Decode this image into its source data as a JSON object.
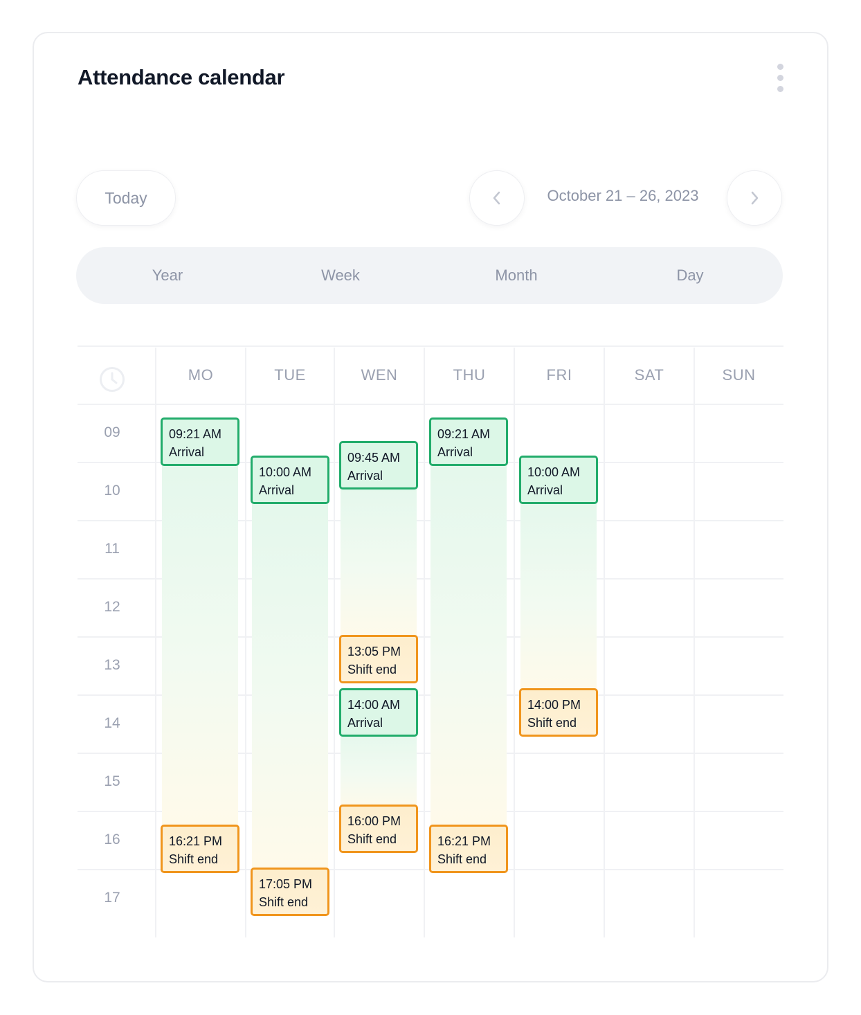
{
  "header": {
    "title": "Attendance calendar",
    "menu_icon": "kebab-menu-icon"
  },
  "toolbar": {
    "today_label": "Today",
    "prev_icon": "chevron-left-icon",
    "next_icon": "chevron-right-icon",
    "date_range": "October 21 – 26, 2023"
  },
  "view_tabs": [
    {
      "label": "Year"
    },
    {
      "label": "Week"
    },
    {
      "label": "Month"
    },
    {
      "label": "Day"
    }
  ],
  "calendar": {
    "time_icon": "clock-icon",
    "days": [
      "MO",
      "TUE",
      "WEN",
      "THU",
      "FRI",
      "SAT",
      "SUN"
    ],
    "hours": [
      "09",
      "10",
      "11",
      "12",
      "13",
      "14",
      "15",
      "16",
      "17"
    ],
    "colors": {
      "arrival_border": "#22ac6b",
      "arrival_bg": "#dcf7e7",
      "shift_end_border": "#f0951d",
      "shift_end_bg": "#fdedcb"
    },
    "events": [
      {
        "day": 0,
        "type": "arrival",
        "time": "09:21 AM",
        "label": "Arrival",
        "h": 9,
        "m": 21
      },
      {
        "day": 0,
        "type": "shiftend",
        "time": "16:21 PM",
        "label": "Shift end",
        "h": 16,
        "m": 21
      },
      {
        "day": 1,
        "type": "arrival",
        "time": "10:00 AM",
        "label": "Arrival",
        "h": 10,
        "m": 0
      },
      {
        "day": 1,
        "type": "shiftend",
        "time": "17:05 PM",
        "label": "Shift end",
        "h": 17,
        "m": 5
      },
      {
        "day": 2,
        "type": "arrival",
        "time": "09:45 AM",
        "label": "Arrival",
        "h": 9,
        "m": 45
      },
      {
        "day": 2,
        "type": "shiftend",
        "time": "13:05 PM",
        "label": "Shift end",
        "h": 13,
        "m": 5
      },
      {
        "day": 2,
        "type": "arrival",
        "time": "14:00 AM",
        "label": "Arrival",
        "h": 14,
        "m": 0
      },
      {
        "day": 2,
        "type": "shiftend",
        "time": "16:00 PM",
        "label": "Shift end",
        "h": 16,
        "m": 0
      },
      {
        "day": 3,
        "type": "arrival",
        "time": "09:21 AM",
        "label": "Arrival",
        "h": 9,
        "m": 21
      },
      {
        "day": 3,
        "type": "shiftend",
        "time": "16:21 PM",
        "label": "Shift end",
        "h": 16,
        "m": 21
      },
      {
        "day": 4,
        "type": "arrival",
        "time": "10:00 AM",
        "label": "Arrival",
        "h": 10,
        "m": 0
      },
      {
        "day": 4,
        "type": "shiftend",
        "time": "14:00 PM",
        "label": "Shift end",
        "h": 14,
        "m": 0
      }
    ]
  }
}
